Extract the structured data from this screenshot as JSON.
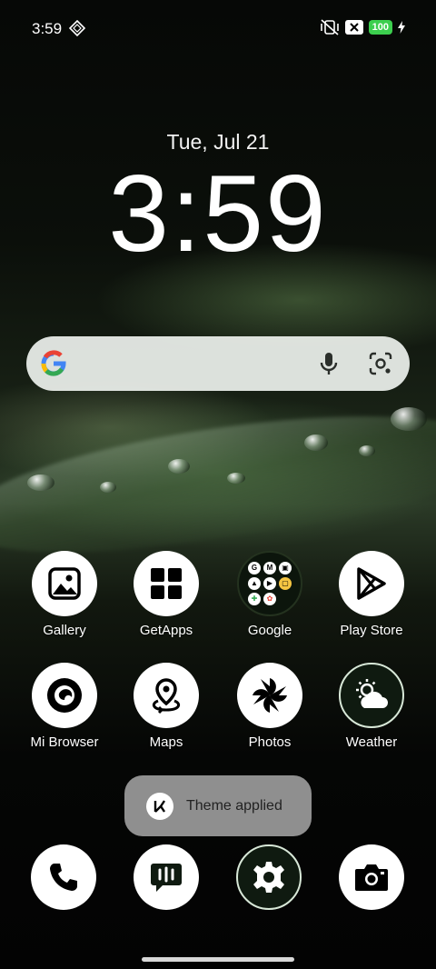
{
  "status_bar": {
    "time": "3:59",
    "battery": "100",
    "icons": [
      "diamond-icon",
      "mute-vibrate-icon",
      "close-badge-icon",
      "charging-bolt-icon"
    ]
  },
  "lockscreen": {
    "date": "Tue, Jul 21",
    "clock": "3:59"
  },
  "search_bar": {
    "icons": [
      "google-logo",
      "mic-icon",
      "lens-icon"
    ]
  },
  "apps_row1": [
    {
      "label": "Gallery",
      "icon": "gallery-icon"
    },
    {
      "label": "GetApps",
      "icon": "getapps-icon"
    },
    {
      "label": "Google",
      "icon": "google-folder"
    },
    {
      "label": "Play Store",
      "icon": "play-store-icon"
    }
  ],
  "apps_row2": [
    {
      "label": "Mi Browser",
      "icon": "mi-browser-icon"
    },
    {
      "label": "Maps",
      "icon": "maps-icon"
    },
    {
      "label": "Photos",
      "icon": "photos-icon"
    },
    {
      "label": "Weather",
      "icon": "weather-icon"
    }
  ],
  "folder_minis": [
    "G",
    "M",
    "▣",
    "▲",
    "▶",
    "▢",
    "✚",
    "✿"
  ],
  "toast": {
    "text": "Theme applied"
  },
  "dock": [
    "phone-icon",
    "messaging-icon",
    "settings-icon",
    "camera-icon"
  ],
  "colors": {
    "battery_green": "#3ccf4e",
    "icon_dark": "#0f1a10",
    "toast_bg": "#9b9b9b"
  }
}
